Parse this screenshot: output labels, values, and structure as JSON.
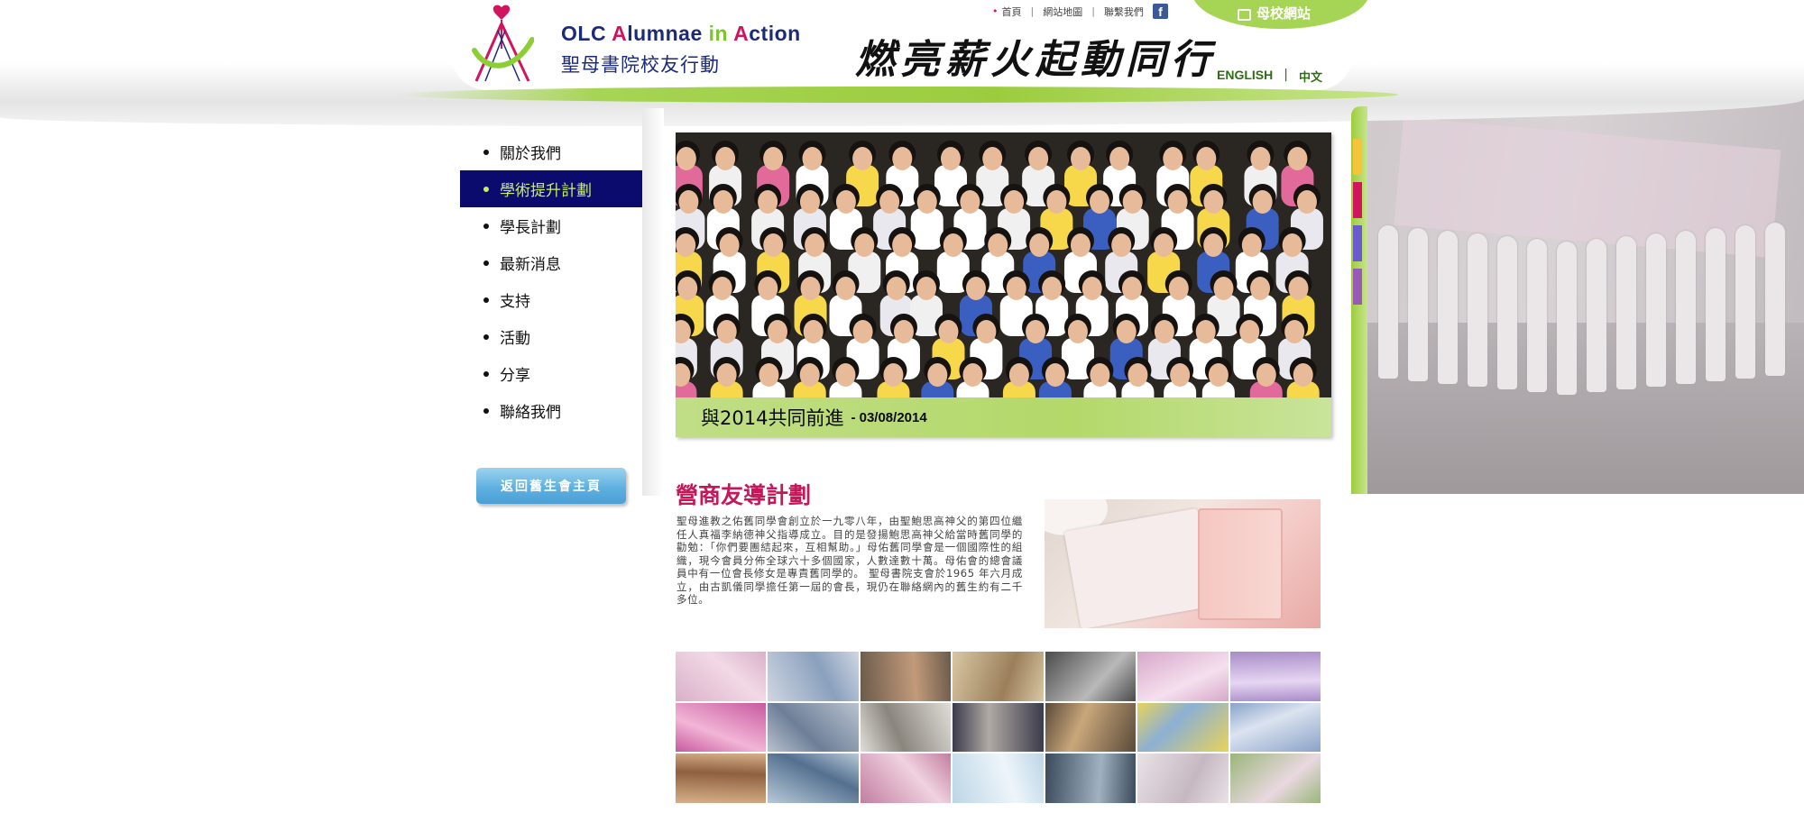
{
  "header": {
    "logo_en_parts": [
      {
        "text": "OLC ",
        "accent": "navy"
      },
      {
        "text": "A",
        "accent": "red"
      },
      {
        "text": "lumnae ",
        "accent": "navy"
      },
      {
        "text": "in",
        "accent": "green"
      },
      {
        "text": " ",
        "accent": "navy"
      },
      {
        "text": "A",
        "accent": "red"
      },
      {
        "text": "ction",
        "accent": "navy"
      }
    ],
    "logo_zh": "聖母書院校友行動",
    "slogan": "燃亮薪火起動同行",
    "top_links": [
      "首頁",
      "網站地圖",
      "聯繫我們"
    ],
    "school_site": "母校網站",
    "lang": {
      "english": "ENGLISH",
      "chinese": "中文"
    }
  },
  "sidebar": {
    "items": [
      {
        "label": "關於我們",
        "active": false
      },
      {
        "label": "學術提升計劃",
        "active": true
      },
      {
        "label": "學長計劃",
        "active": false
      },
      {
        "label": "最新消息",
        "active": false
      },
      {
        "label": "支持",
        "active": false
      },
      {
        "label": "活動",
        "active": false
      },
      {
        "label": "分享",
        "active": false
      },
      {
        "label": "聯絡我們",
        "active": false
      }
    ],
    "back_button": "返回舊生會主頁"
  },
  "hero": {
    "caption_title": "與2014共同前進",
    "caption_date": "- 03/08/2014"
  },
  "section": {
    "title": "營商友導計劃",
    "body": "聖母進教之佑舊同學會創立於一九零八年，由聖鮑思高神父的第四位繼任人真福李納德神父指導成立。目的是發揚鮑思高神父給當時舊同學的勸勉：「你們要團結起來，互相幫助。」母佑舊同學會是一個國際性的組織，現今會員分佈全球六十多個國家，人數達數十萬。母佑會的總會議員中有一位會長修女是專責舊同學的。 聖母書院支會於1965 年六月成立，由古凱儀同學擔任第一屆的會長，現仍在聯絡網內的舊生約有二千多位。"
  },
  "colors": {
    "navy": "#1c2a7a",
    "red": "#d0145e",
    "green": "#7cc42d",
    "nav_active_bg": "#0b0b6e",
    "nav_active_text": "#c6ee6a",
    "accent_green": "#a6d454",
    "section_title": "#c4185a"
  },
  "icons": {
    "facebook": "facebook-icon",
    "lock": "lock-icon"
  }
}
